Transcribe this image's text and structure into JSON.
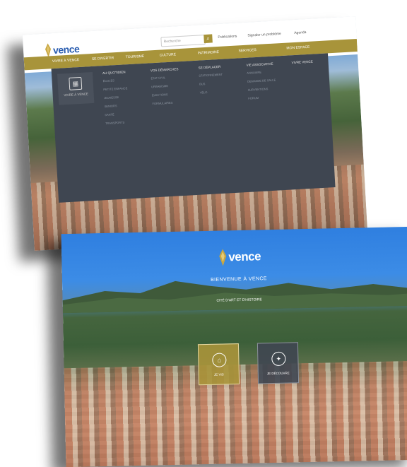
{
  "site": {
    "logo_text": "vence",
    "brand_gold": "#a8943a",
    "brand_dark": "#3f4651"
  },
  "shot1": {
    "search_placeholder": "Recherche",
    "search_button_icon": "search-icon",
    "utility": [
      "Publications",
      "Signaler un problème",
      "Agenda"
    ],
    "nav": [
      "Vivre à Vence",
      "Se divertir",
      "Tourisme",
      "Culture",
      "Patrimoine",
      "Services",
      "Mon espace"
    ],
    "mega_tile_label": "Vivre à Vence",
    "mega_columns": [
      {
        "heading": "Au quotidien",
        "items": [
          "Écoles",
          "Petite enfance",
          "Jeunesse",
          "Seniors",
          "Santé",
          "Transports"
        ]
      },
      {
        "heading": "Vos démarches",
        "items": [
          "État civil",
          "Urbanisme",
          "Élections",
          "Formulaires"
        ]
      },
      {
        "heading": "Se déplacer",
        "items": [
          "Stationnement",
          "Bus",
          "Vélo"
        ]
      },
      {
        "heading": "Vie associative",
        "items": [
          "Annuaire",
          "Demande de salle",
          "Subventions",
          "Forum"
        ]
      },
      {
        "heading": "Vivre Vence",
        "items": []
      }
    ]
  },
  "shot2": {
    "welcome": "BIENVENUE À VENCE",
    "tagline": "CITÉ D'ART ET D'HISTOIRE",
    "buttons": [
      {
        "label": "Je vis",
        "icon": "home-icon"
      },
      {
        "label": "Je découvre",
        "icon": "compass-icon"
      }
    ]
  }
}
